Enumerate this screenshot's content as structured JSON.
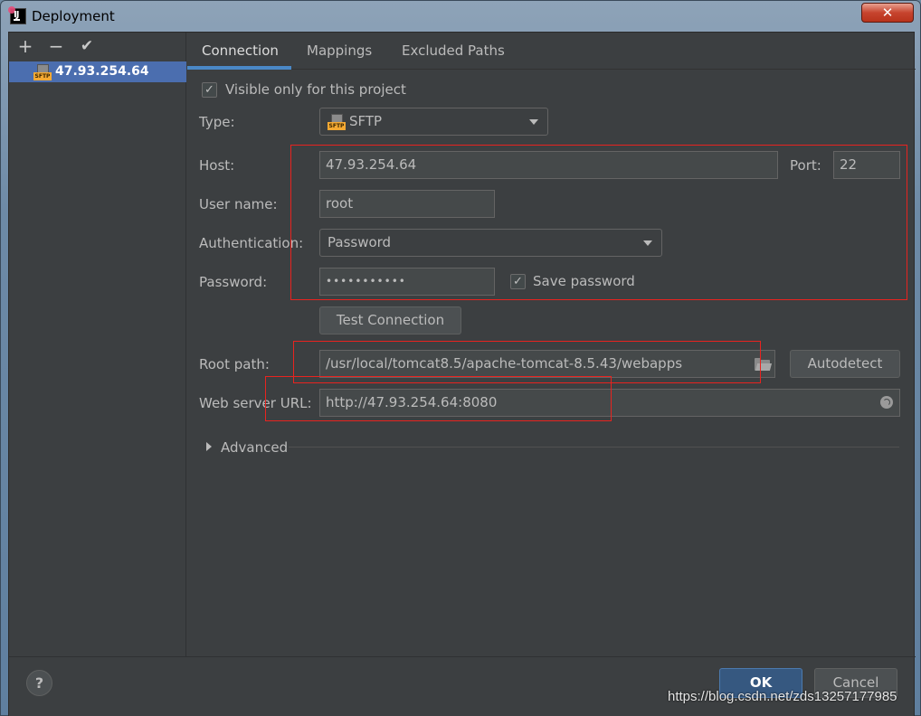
{
  "window": {
    "title": "Deployment",
    "close_label": "✕"
  },
  "sidebar": {
    "toolbar": {
      "add": "+",
      "remove": "−",
      "apply": "✔"
    },
    "servers": [
      {
        "name": "47.93.254.64",
        "icon": "sftp-icon",
        "selected": true
      }
    ]
  },
  "tabs": [
    {
      "label": "Connection",
      "active": true
    },
    {
      "label": "Mappings",
      "active": false
    },
    {
      "label": "Excluded Paths",
      "active": false
    }
  ],
  "connection": {
    "visible_only": {
      "label": "Visible only for this project",
      "checked": true
    },
    "type": {
      "label": "Type:",
      "value": "SFTP",
      "icon_tag": "SFTP"
    },
    "host": {
      "label": "Host:",
      "value": "47.93.254.64"
    },
    "port": {
      "label": "Port:",
      "value": "22"
    },
    "username": {
      "label": "User name:",
      "value": "root"
    },
    "authentication": {
      "label": "Authentication:",
      "value": "Password"
    },
    "password": {
      "label": "Password:",
      "masked_value": "•••••••••••"
    },
    "save_password": {
      "label": "Save password",
      "checked": true
    },
    "test_connection_label": "Test Connection",
    "root_path": {
      "label": "Root path:",
      "value": "/usr/local/tomcat8.5/apache-tomcat-8.5.43/webapps"
    },
    "autodetect_label": "Autodetect",
    "web_server_url": {
      "label": "Web server URL:",
      "value": "http://47.93.254.64:8080"
    },
    "advanced_label": "Advanced"
  },
  "footer": {
    "help_label": "?",
    "ok_label": "OK",
    "cancel_label": "Cancel"
  },
  "watermark": "https://blog.csdn.net/zds13257177985",
  "colors": {
    "accent": "#4a88c7",
    "selection": "#4b6eaf",
    "annotation_red": "#e8231f",
    "ok_button": "#365880"
  }
}
